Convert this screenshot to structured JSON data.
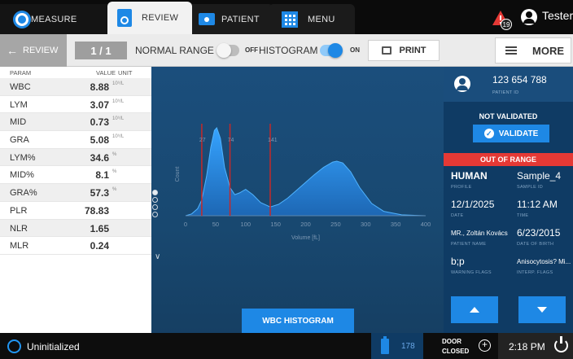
{
  "tabs": {
    "measure": "MEASURE",
    "review": "REVIEW",
    "patient": "PATIENT",
    "menu": "MENU"
  },
  "header": {
    "alert_count": "19",
    "user": "Tester"
  },
  "toolbar": {
    "back": "REVIEW",
    "page": "1 / 1",
    "normal_range_label": "NORMAL RANGE",
    "normal_range_state": "OFF",
    "histogram_label": "HISTOGRAM",
    "histogram_state": "ON",
    "print": "PRINT",
    "more": "MORE"
  },
  "params": {
    "headers": {
      "param": "PARAM",
      "value": "VALUE",
      "unit": "UNIT"
    },
    "rows": [
      {
        "name": "WBC",
        "value": "8.88",
        "unit": "10⁹/L"
      },
      {
        "name": "LYM",
        "value": "3.07",
        "unit": "10⁹/L"
      },
      {
        "name": "MID",
        "value": "0.73",
        "unit": "10⁹/L"
      },
      {
        "name": "GRA",
        "value": "5.08",
        "unit": "10⁹/L"
      },
      {
        "name": "LYM%",
        "value": "34.6",
        "unit": "%"
      },
      {
        "name": "MID%",
        "value": "8.1",
        "unit": "%"
      },
      {
        "name": "GRA%",
        "value": "57.3",
        "unit": "%"
      },
      {
        "name": "PLR",
        "value": "78.83",
        "unit": ""
      },
      {
        "name": "NLR",
        "value": "1.65",
        "unit": ""
      },
      {
        "name": "MLR",
        "value": "0.24",
        "unit": ""
      }
    ]
  },
  "chart_data": {
    "type": "area",
    "title": "",
    "xlabel": "Volume [fL]",
    "ylabel": "Count",
    "xlim": [
      0,
      400
    ],
    "xticks": [
      0,
      50,
      100,
      150,
      200,
      250,
      300,
      350,
      400
    ],
    "grid": false,
    "discriminators": [
      27,
      74,
      141
    ],
    "x": [
      0,
      10,
      20,
      27,
      35,
      42,
      48,
      52,
      58,
      65,
      74,
      82,
      90,
      100,
      112,
      125,
      141,
      155,
      170,
      185,
      200,
      215,
      230,
      245,
      252,
      262,
      275,
      290,
      310,
      330,
      360,
      400
    ],
    "y": [
      0,
      2,
      8,
      18,
      45,
      78,
      97,
      100,
      88,
      55,
      32,
      24,
      26,
      30,
      24,
      15,
      10,
      13,
      20,
      29,
      38,
      47,
      55,
      61,
      62,
      60,
      50,
      32,
      14,
      5,
      1,
      0
    ]
  },
  "histogram_tab": "WBC HISTOGRAM",
  "patient": {
    "id": "123 654 788",
    "id_label": "PATIENT ID",
    "validation_status": "NOT VALIDATED",
    "validate": "VALIDATE",
    "range_status": "OUT OF RANGE",
    "profile": "HUMAN",
    "profile_label": "PROFILE",
    "sample_id": "Sample_4",
    "sample_id_label": "SAMPLE ID",
    "date": "12/1/2025",
    "date_label": "DATE",
    "time": "11:12 AM",
    "time_label": "TIME",
    "name": "MR., Zoltán Kovács",
    "name_label": "PATIENT NAME",
    "dob": "6/23/2015",
    "dob_label": "DATE OF BIRTH",
    "warning_flags": "b;p",
    "warning_flags_label": "WARNING FLAGS",
    "interp_flags": "Anisocytosis? Mi...",
    "interp_flags_label": "INTERP. FLAGS"
  },
  "status": {
    "text": "Uninitialized",
    "reagent": "178",
    "door_line1": "DOOR",
    "door_line2": "CLOSED",
    "clock": "2:18 PM"
  },
  "colors": {
    "accent": "#1e88e5",
    "alert": "#e53935",
    "panel": "#0f3b64",
    "discriminator": "#c62828"
  }
}
